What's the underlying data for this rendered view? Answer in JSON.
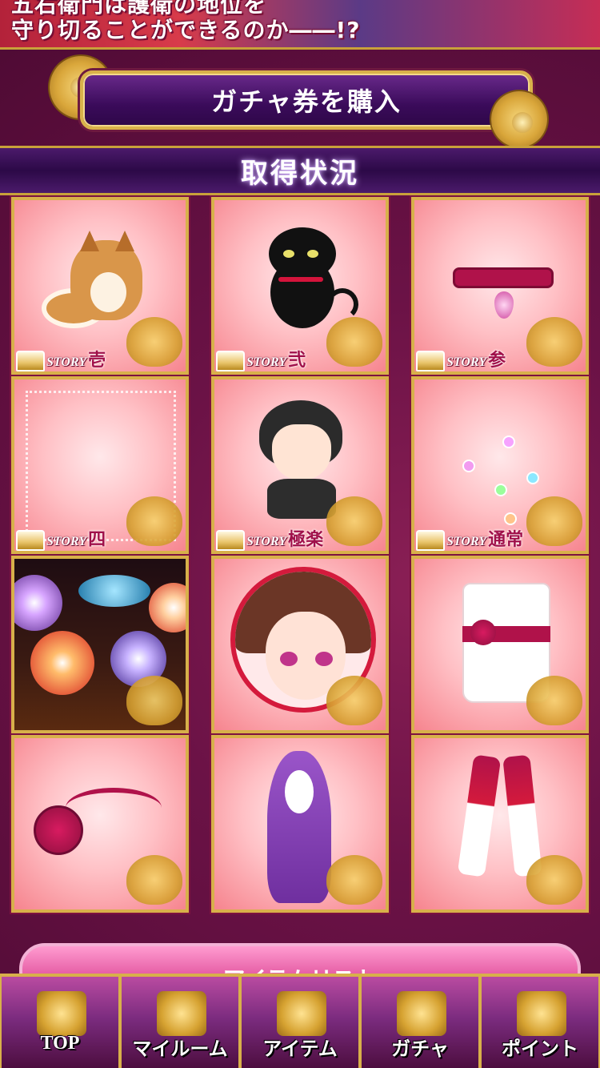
{
  "banner": {
    "line1": "五右衛門は護衛の地位を",
    "line2": "守り切ることができるのか――!?"
  },
  "purchase": {
    "label": "ガチャ券を購入"
  },
  "section": {
    "title": "取得状況"
  },
  "cards": [
    {
      "story": true,
      "story_label": "STORY",
      "story_num": "壱",
      "item": "fox"
    },
    {
      "story": true,
      "story_label": "STORY",
      "story_num": "弐",
      "item": "black-cat"
    },
    {
      "story": true,
      "story_label": "STORY",
      "story_num": "参",
      "item": "choker"
    },
    {
      "story": true,
      "story_label": "STORY",
      "story_num": "四",
      "item": "sparkle-frame"
    },
    {
      "story": true,
      "story_label": "STORY",
      "story_num": "極楽",
      "item": "boy-character"
    },
    {
      "story": true,
      "story_label": "STORY",
      "story_num": "通常",
      "item": "crystal-tree"
    },
    {
      "story": false,
      "item": "umbrella-background"
    },
    {
      "story": false,
      "item": "girl-portrait"
    },
    {
      "story": false,
      "item": "white-kimono"
    },
    {
      "story": false,
      "item": "rose-hairpin"
    },
    {
      "story": false,
      "item": "purple-wig"
    },
    {
      "story": false,
      "item": "red-boots"
    }
  ],
  "item_list": {
    "label": "アイテムリスト"
  },
  "tabbar": {
    "items": [
      {
        "label": "TOP",
        "icon": "castle-icon"
      },
      {
        "label": "マイルーム",
        "icon": "crane-icon"
      },
      {
        "label": "アイテム",
        "icon": "pouch-icon"
      },
      {
        "label": "ガチャ",
        "icon": "flower-crest-icon"
      },
      {
        "label": "ポイント",
        "icon": "moon-flower-icon"
      }
    ]
  },
  "colors": {
    "accent_gold": "#d8b04a",
    "card_pink": "#ffc0c5",
    "background_plum": "#5a0c3c"
  }
}
